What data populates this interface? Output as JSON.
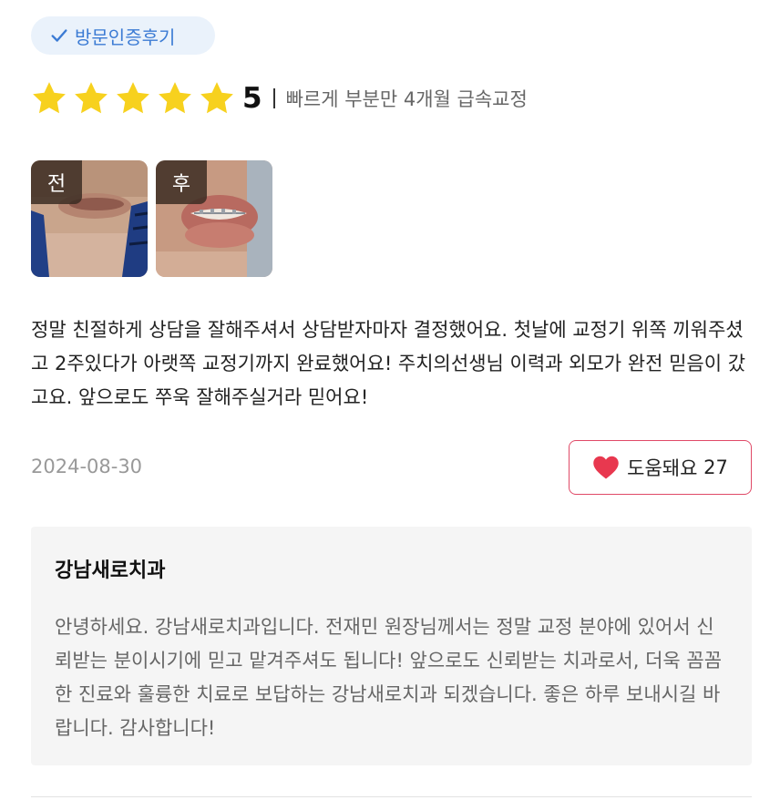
{
  "badge": {
    "label": "방문인증후기",
    "icon": "check-icon",
    "color": "#3b7bd4"
  },
  "rating": {
    "stars": 5,
    "max_stars": 5,
    "score": "5",
    "treatment": "빠르게 부분만 4개월 급속교정",
    "star_color": "#f7d11e"
  },
  "photos": [
    {
      "tag": "전"
    },
    {
      "tag": "후"
    }
  ],
  "review": {
    "text": "정말 친절하게 상담을 잘해주셔서 상담받자마자 결정했어요. 첫날에 교정기 위쪽 끼워주셨고 2주있다가 아랫쪽 교정기까지 완료했어요! 주치의선생님 이력과 외모가 완전 믿음이 갔고요. 앞으로도 쭈욱 잘해주실거라 믿어요!",
    "date": "2024-08-30"
  },
  "helpful": {
    "label": "도움돼요",
    "count": "27",
    "icon": "heart-icon",
    "color": "#e8384f"
  },
  "reply": {
    "clinic_name": "강남새로치과",
    "text": "안녕하세요. 강남새로치과입니다. 전재민 원장님께서는 정말 교정 분야에 있어서 신뢰받는 분이시기에 믿고 맡겨주셔도 됩니다! 앞으로도 신뢰받는 치과로서, 더욱 꼼꼼한 진료와 훌륭한 치료로 보답하는 강남새로치과 되겠습니다. 좋은 하루 보내시길 바랍니다. 감사합니다!"
  }
}
